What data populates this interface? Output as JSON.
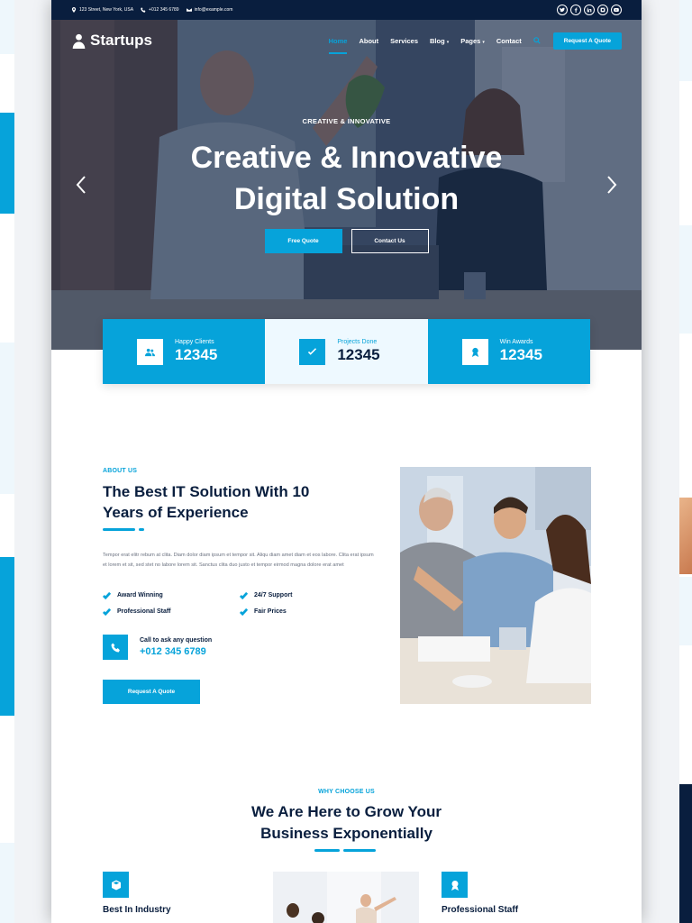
{
  "topbar": {
    "address": "123 Street, New York, USA",
    "phone": "+012 345 6789",
    "email": "info@example.com",
    "socials": [
      "twitter-icon",
      "facebook-icon",
      "linkedin-icon",
      "instagram-icon",
      "youtube-icon"
    ]
  },
  "nav": {
    "brand": "Startups",
    "items": [
      {
        "label": "Home",
        "active": true
      },
      {
        "label": "About"
      },
      {
        "label": "Services"
      },
      {
        "label": "Blog",
        "dropdown": true
      },
      {
        "label": "Pages",
        "dropdown": true
      },
      {
        "label": "Contact"
      }
    ],
    "cta": "Request A Quote"
  },
  "hero": {
    "subtitle": "CREATIVE & INNOVATIVE",
    "title_line1": "Creative & Innovative",
    "title_line2": "Digital Solution",
    "btn_primary": "Free Quote",
    "btn_secondary": "Contact Us"
  },
  "facts": [
    {
      "label": "Happy Clients",
      "value": "12345",
      "icon": "users-icon"
    },
    {
      "label": "Projects Done",
      "value": "12345",
      "icon": "check-icon"
    },
    {
      "label": "Win Awards",
      "value": "12345",
      "icon": "award-icon"
    }
  ],
  "about": {
    "eyebrow": "ABOUT US",
    "title_line1": "The Best IT Solution With 10",
    "title_line2": "Years of Experience",
    "text": "Tempor erat elitr rebum at clita. Diam dolor diam ipsum et tempor sit. Aliqu diam amet diam et eos labore. Clita erat ipsum et lorem et sit, sed stet no labore lorem sit. Sanctus clita duo justo et tempor eirmod magna dolore erat amet",
    "checks": [
      "Award Winning",
      "24/7 Support",
      "Professional Staff",
      "Fair Prices"
    ],
    "call_label": "Call to ask any question",
    "call_number": "+012 345 6789",
    "button": "Request A Quote"
  },
  "why": {
    "eyebrow": "WHY CHOOSE US",
    "title_line1": "We Are Here to Grow Your",
    "title_line2": "Business Exponentially",
    "features": [
      {
        "title": "Best In Industry",
        "icon": "cube-icon"
      },
      {
        "title": "Professional Staff",
        "icon": "award-icon"
      }
    ]
  },
  "colors": {
    "primary": "#06a3da",
    "dark": "#091e3e",
    "light": "#eef9ff"
  }
}
